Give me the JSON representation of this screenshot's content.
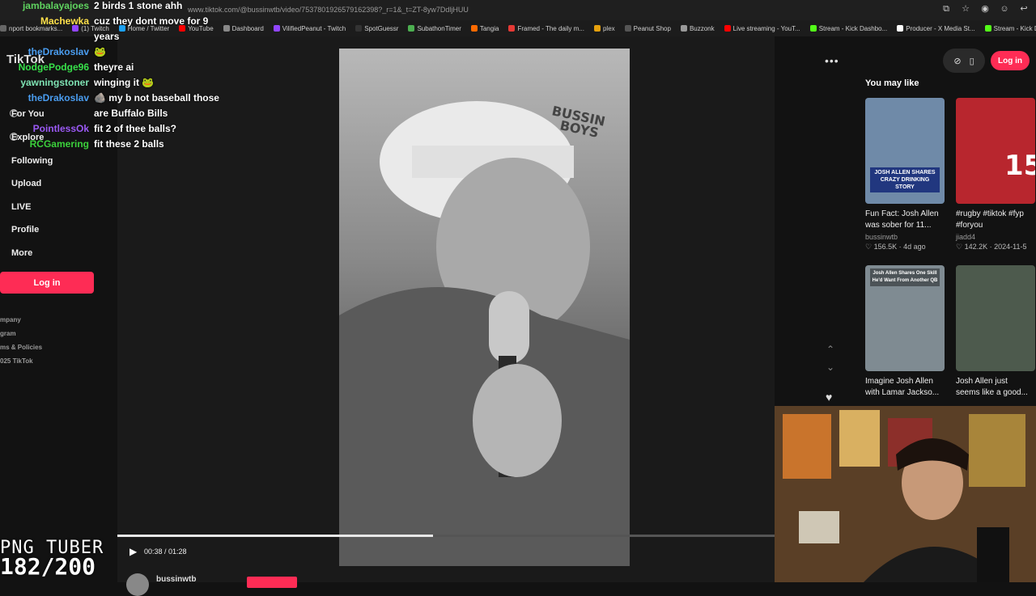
{
  "browser": {
    "url": "www.tiktok.com/@bussinwtb/video/7537801926579162398?_r=1&_t=ZT-8yw7DdljHUU",
    "bookmarks": [
      {
        "label": "nport bookmarks...",
        "color": "#666"
      },
      {
        "label": "(1) Twitch",
        "color": "#9146ff"
      },
      {
        "label": "Home / Twitter",
        "color": "#1da1f2"
      },
      {
        "label": "YouTube",
        "color": "#ff0000"
      },
      {
        "label": "Dashboard",
        "color": "#888"
      },
      {
        "label": "VilifiedPeanut - Twitch",
        "color": "#9146ff"
      },
      {
        "label": "SpotGuessr",
        "color": "#333"
      },
      {
        "label": "SubathonTimer",
        "color": "#4caf50"
      },
      {
        "label": "Tangia",
        "color": "#ff6a00"
      },
      {
        "label": "Framed - The daily m...",
        "color": "#e53935"
      },
      {
        "label": "plex",
        "color": "#e5a00d"
      },
      {
        "label": "Peanut Shop",
        "color": "#555"
      },
      {
        "label": "Buzzonk",
        "color": "#999"
      },
      {
        "label": "Live streaming - YouT...",
        "color": "#ff0000"
      },
      {
        "label": "Stream - Kick Dashbo...",
        "color": "#53fc18"
      },
      {
        "label": "Producer - X Media St...",
        "color": "#fff"
      },
      {
        "label": "Stream - Kick Dashbo...",
        "color": "#53fc18"
      }
    ]
  },
  "sidebar": {
    "logo": "TikTok",
    "items": [
      {
        "label": "For You",
        "icon": "home-icon"
      },
      {
        "label": "Explore",
        "icon": "compass-icon"
      },
      {
        "label": "Following",
        "icon": "following-icon"
      },
      {
        "label": "Upload",
        "icon": "upload-icon"
      },
      {
        "label": "LIVE",
        "icon": "live-icon"
      },
      {
        "label": "Profile",
        "icon": "profile-icon"
      },
      {
        "label": "More",
        "icon": "more-icon"
      }
    ],
    "login_label": "Log in",
    "footer": [
      "mpany",
      "gram",
      "ms & Policies",
      "025 TikTok"
    ]
  },
  "player": {
    "current_time": "00:38",
    "total_time": "01:28",
    "time_label": "00:38 / 01:28",
    "progress": 0.48,
    "author": "bussinwtb"
  },
  "right": {
    "login_label": "Log in",
    "section_title": "You may like",
    "cards": [
      {
        "caption": "JOSH ALLEN SHARES CRAZY DRINKING STORY",
        "title_1": "Fun Fact: Josh Allen",
        "title_2": "was sober for 11...",
        "author": "bussinwtb",
        "likes": "156.5K",
        "date": "4d ago",
        "bg": "#6f8aa8"
      },
      {
        "caption": "",
        "title_1": "#rugby #tiktok #fyp",
        "title_2": "#foryou",
        "author": "jiadd4",
        "likes": "142.2K",
        "date": "2024-11-5",
        "bg": "#b8262e"
      },
      {
        "caption": "Josh Allen Shares One Skill He'd Want From Another QB",
        "title_1": "Imagine Josh Allen",
        "title_2": "with Lamar Jackso...",
        "author": "",
        "likes": "",
        "date": "",
        "bg": "#7f8b92"
      },
      {
        "caption": "",
        "title_1": "Josh Allen just",
        "title_2": "seems like a good...",
        "author": "",
        "likes": "",
        "date": "",
        "bg": "#4d5a4d"
      }
    ]
  },
  "chat": [
    {
      "user": "jambalayajoes",
      "msg": "2 birds 1 stone ahh",
      "color": "#5fd35f"
    },
    {
      "user": "Machewka",
      "msg": "cuz they dont move for 9",
      "color": "#ffe14a"
    },
    {
      "user": "",
      "msg": "years",
      "color": "#fff"
    },
    {
      "user": "theDrakoslav",
      "msg": "🐸",
      "color": "#4a9df0"
    },
    {
      "user": "NodgePodge96",
      "msg": "theyre ai",
      "color": "#37e04a"
    },
    {
      "user": "yawningstoner",
      "msg": "winging it 🐸",
      "color": "#7fe3b4"
    },
    {
      "user": "theDrakoslav",
      "msg": "🪨 my b not baseball those",
      "color": "#4a9df0"
    },
    {
      "user": "",
      "msg": "are Buffalo Bills",
      "color": "#fff"
    },
    {
      "user": "PointlessOk",
      "msg": "fit 2 of thee balls?",
      "color": "#9b59f5"
    },
    {
      "user": "RCGamering",
      "msg": "fit these 2 balls",
      "color": "#3bd13b"
    }
  ],
  "overlay": {
    "png_tuber": "PNG TUBER",
    "count": "182/200"
  }
}
